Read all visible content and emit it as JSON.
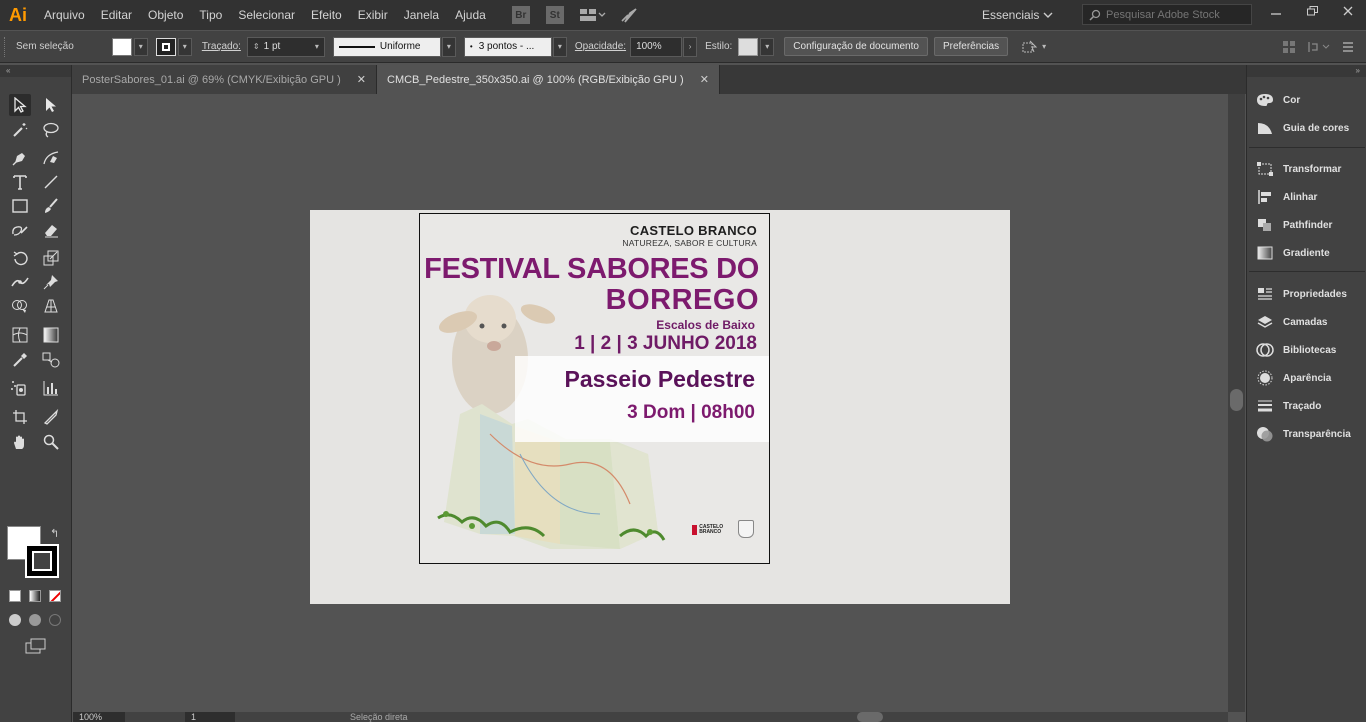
{
  "app": {
    "logo": "Ai"
  },
  "menu": [
    "Arquivo",
    "Editar",
    "Objeto",
    "Tipo",
    "Selecionar",
    "Efeito",
    "Exibir",
    "Janela",
    "Ajuda"
  ],
  "menubar_icons": {
    "bridge": "Br",
    "stock": "St"
  },
  "workspace": {
    "label": "Essenciais"
  },
  "stock_search": {
    "placeholder": "Pesquisar Adobe Stock"
  },
  "control_bar": {
    "selection": "Sem seleção",
    "stroke_label": "Traçado:",
    "stroke_weight": "1 pt",
    "stroke_profile": "Uniforme",
    "brush": "3 pontos - ...",
    "opacity_label": "Opacidade:",
    "opacity_value": "100%",
    "style_label": "Estilo:",
    "doc_setup_button": "Configuração de documento",
    "preferences_button": "Preferências"
  },
  "tabs": [
    {
      "label": "PosterSabores_01.ai @ 69% (CMYK/Exibição GPU )",
      "active": false
    },
    {
      "label": "CMCB_Pedestre_350x350.ai @ 100% (RGB/Exibição GPU )",
      "active": true
    }
  ],
  "tab_close": "✕",
  "poster": {
    "city": "CASTELO BRANCO",
    "tagline": "NATUREZA, SABOR E CULTURA",
    "festival_line1": "FESTIVAL SABORES DO",
    "festival_line2": "BORREGO",
    "village": "Escalos de Baixo",
    "dates": "1 | 2 | 3 JUNHO 2018",
    "walk": "Passeio Pedestre",
    "time": "3 Dom | 08h00",
    "logo_text": "CASTELO BRANCO",
    "colors": {
      "purple": "#7d1a6e",
      "dark_purple": "#5a1259",
      "red": "#c8102e"
    }
  },
  "right_panel": {
    "groups": [
      [
        {
          "label": "Cor",
          "icon": "palette-icon"
        },
        {
          "label": "Guia de cores",
          "icon": "color-guide-icon"
        }
      ],
      [
        {
          "label": "Transformar",
          "icon": "transform-icon"
        },
        {
          "label": "Alinhar",
          "icon": "align-icon"
        },
        {
          "label": "Pathfinder",
          "icon": "pathfinder-icon"
        },
        {
          "label": "Gradiente",
          "icon": "gradient-icon"
        }
      ],
      [
        {
          "label": "Propriedades",
          "icon": "properties-icon"
        },
        {
          "label": "Camadas",
          "icon": "layers-icon"
        },
        {
          "label": "Bibliotecas",
          "icon": "libraries-icon"
        },
        {
          "label": "Aparência",
          "icon": "appearance-icon"
        },
        {
          "label": "Traçado",
          "icon": "stroke-icon"
        },
        {
          "label": "Transparência",
          "icon": "transparency-icon"
        }
      ]
    ]
  },
  "status_bar": {
    "zoom": "100%",
    "page": "1",
    "tool": "Seleção direta"
  },
  "theme": {
    "menubar": "#323232",
    "panel": "#424242",
    "canvas": "#535353",
    "accent_logo": "#ff9a00"
  }
}
